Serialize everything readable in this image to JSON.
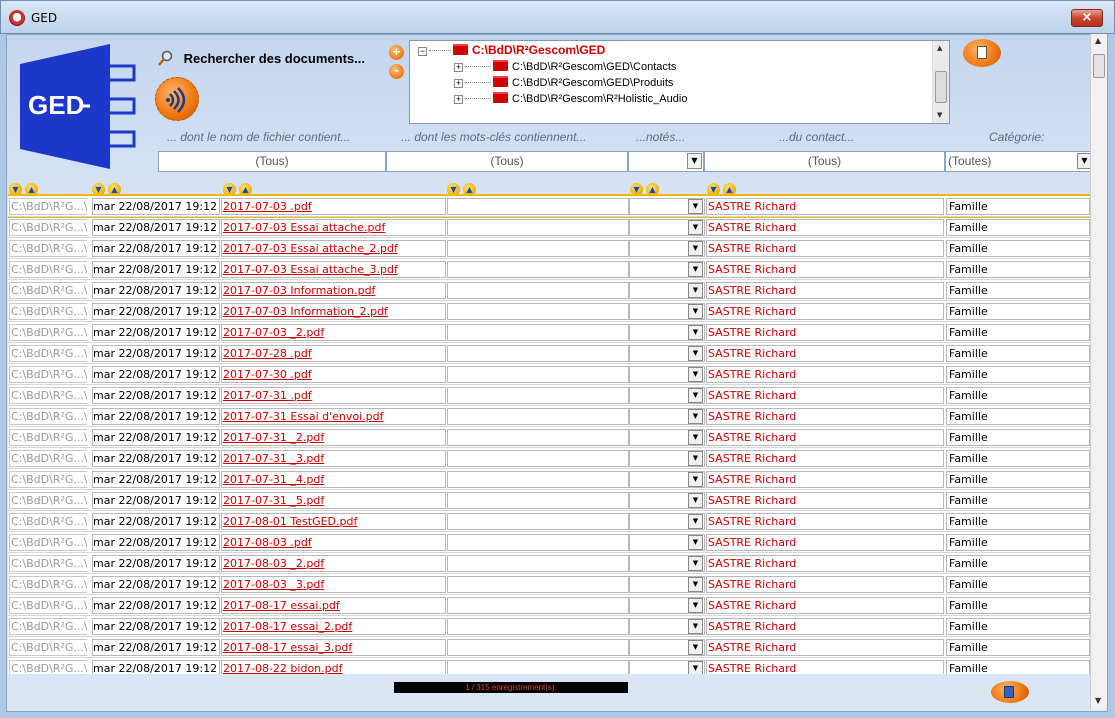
{
  "window": {
    "title": "GED",
    "close_symbol": "×"
  },
  "header": {
    "logo_text": "GED",
    "search_title": "Rechercher des documents...",
    "plus_label": "+",
    "minus_label": "-"
  },
  "tree": {
    "root": "C:\\BdD\\R²Gescom\\GED",
    "children": [
      "C:\\BdD\\R²Gescom\\GED\\Contacts",
      "C:\\BdD\\R²Gescom\\GED\\Produits",
      "C:\\BdD\\R²Gescom\\R²Holistic_Audio"
    ]
  },
  "filters": {
    "labels": [
      "... dont le nom de fichier contient...",
      "... dont les mots-clés contiennent...",
      "...notés...",
      "...du contact...",
      "Catégorie:"
    ],
    "filename_value": "(Tous)",
    "keywords_value": "(Tous)",
    "contact_value": "(Tous)",
    "category_value": "(Toutes)"
  },
  "grid": {
    "path_value": "C:\\BdD\\R²G...\\",
    "date_value": "mar 22/08/2017 19:12",
    "contact_value": "SASTRE Richard",
    "category_value": "Famille",
    "files": [
      "2017-07-03 .pdf",
      "2017-07-03 Essai attache.pdf",
      "2017-07-03 Essai attache_2.pdf",
      "2017-07-03 Essai attache_3.pdf",
      "2017-07-03 Information.pdf",
      "2017-07-03 Information_2.pdf",
      "2017-07-03 _2.pdf",
      "2017-07-28 .pdf",
      "2017-07-30 .pdf",
      "2017-07-31 .pdf",
      "2017-07-31 Essai d'envoi.pdf",
      "2017-07-31 _2.pdf",
      "2017-07-31 _3.pdf",
      "2017-07-31 _4.pdf",
      "2017-07-31 _5.pdf",
      "2017-08-01 TestGED.pdf",
      "2017-08-03 .pdf",
      "2017-08-03 _2.pdf",
      "2017-08-03 _3.pdf",
      "2017-08-17 essai.pdf",
      "2017-08-17 essai_2.pdf",
      "2017-08-17 essai_3.pdf",
      "2017-08-22 bidon.pdf"
    ]
  },
  "status": {
    "text": "1 / 315 enregistrement(s)."
  },
  "colors": {
    "accent_orange": "#f0760f",
    "link_red": "#c00000",
    "folder_red": "#cc0000"
  },
  "icons": {
    "app": "app-logo-icon",
    "search": "magnifier-icon",
    "audio": "audio-waves-icon",
    "doc": "document-icon",
    "exit": "exit-door-icon",
    "sort_down": "sort-descending-icon",
    "sort_up": "sort-ascending-icon"
  }
}
